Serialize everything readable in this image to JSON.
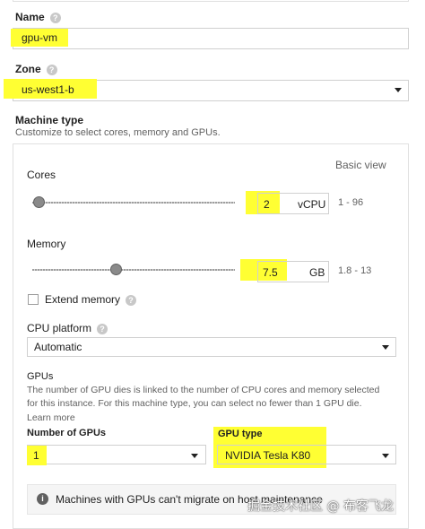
{
  "name_field": {
    "label": "Name",
    "value": "gpu-vm"
  },
  "zone_field": {
    "label": "Zone",
    "value": "us-west1-b"
  },
  "machine_type": {
    "label": "Machine type",
    "description": "Customize to select cores, memory and GPUs.",
    "basic_view_link": "Basic view",
    "cores": {
      "label": "Cores",
      "value": "2",
      "unit": "vCPU",
      "range": "1 - 96",
      "slider_level": 0.03
    },
    "memory": {
      "label": "Memory",
      "value": "7.5",
      "unit": "GB",
      "range": "1.8 - 13",
      "slider_level": 0.41
    },
    "extend_memory": {
      "label": "Extend memory",
      "checked": false
    },
    "cpu_platform": {
      "label": "CPU platform",
      "value": "Automatic"
    },
    "gpus": {
      "label": "GPUs",
      "description_line1": "The number of GPU dies is linked to the number of CPU cores and memory selected",
      "description_line2": "for this instance. For this machine type, you can select no fewer than 1 GPU die.",
      "learn_more": "Learn more",
      "number_label": "Number of GPUs",
      "number_value": "1",
      "type_label": "GPU type",
      "type_value": "NVIDIA Tesla K80"
    },
    "notice": "Machines with GPUs can't migrate on host maintenance"
  },
  "watermark": "掘金技术社区 @ 布客飞龙",
  "colors": {
    "highlight": "#ffff33",
    "border": "#e0e0e0",
    "text": "#212121"
  }
}
